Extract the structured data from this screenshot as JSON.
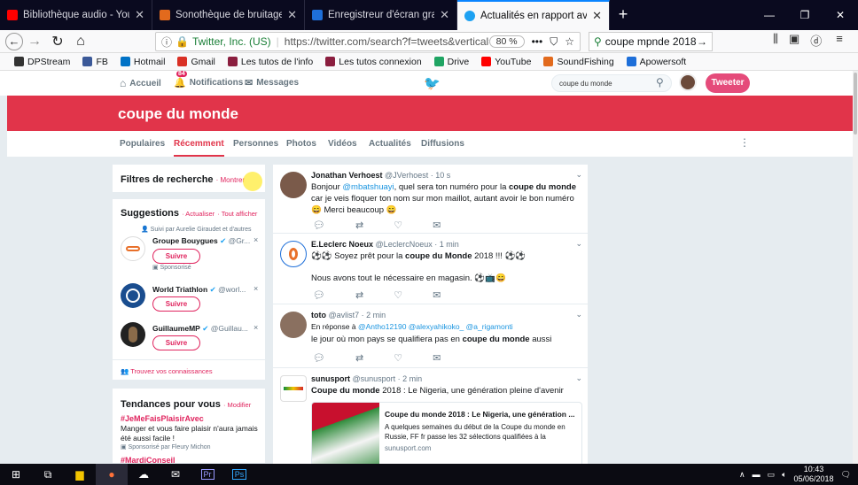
{
  "browser": {
    "tabs": [
      {
        "title": "Bibliothèque audio - YouTube",
        "color": "#ff0000"
      },
      {
        "title": "Sonothèque de bruitages et mu",
        "color": "#e26a1d"
      },
      {
        "title": "Enregistreur d'écran gratuit - en",
        "color": "#1e6fd9"
      },
      {
        "title": "Actualités en rapport avec coup",
        "color": "#1da1f2"
      }
    ],
    "new_tab": "+",
    "url_site": "Twitter, Inc. (US)",
    "url": "https://twitter.com/search?f=tweets&vertical=",
    "zoom": "80 %",
    "search_value": "coupe mpnde 2018",
    "bookmarks": [
      {
        "label": "DPStream",
        "color": "#333333"
      },
      {
        "label": "FB",
        "color": "#3b5998"
      },
      {
        "label": "Hotmail",
        "color": "#0072c6"
      },
      {
        "label": "Gmail",
        "color": "#d93025"
      },
      {
        "label": "Les tutos de l'info",
        "color": "#8b1e3f"
      },
      {
        "label": "Les tutos connexion",
        "color": "#8b1e3f"
      },
      {
        "label": "Drive",
        "color": "#1fa463"
      },
      {
        "label": "YouTube",
        "color": "#ff0000"
      },
      {
        "label": "SoundFishing",
        "color": "#e26a1d"
      },
      {
        "label": "Apowersoft",
        "color": "#1e6fd9"
      }
    ]
  },
  "twitter": {
    "nav_home": "Accueil",
    "nav_notifications": "Notifications",
    "notif_count": "84",
    "nav_messages": "Messages",
    "search_value": "coupe du monde",
    "tweet_button": "Tweeter",
    "banner_title": "coupe du monde",
    "tabs": [
      "Populaires",
      "Récemment",
      "Personnes",
      "Photos",
      "Vidéos",
      "Actualités",
      "Diffusions"
    ],
    "filters": {
      "title": "Filtres de recherche",
      "show": "· Montrer"
    },
    "suggestions": {
      "title": "Suggestions",
      "refresh": "· Actualiser",
      "all": "· Tout afficher",
      "followed_by": "Suivi par Aurelie Giraudet et d'autres",
      "follow_label": "Suivre",
      "sponsored": "Sponsorisé",
      "users": [
        {
          "name": "Groupe Bouygues",
          "handle": "@Gr...",
          "color": "#e8702a"
        },
        {
          "name": "World Triathlon",
          "handle": "@worl...",
          "color": "#1a4d8f"
        },
        {
          "name": "GuillaumeMP",
          "handle": "@Guillau...",
          "color": "#222222"
        }
      ],
      "find_friends": "Trouvez vos connaissances"
    },
    "trends": {
      "title": "Tendances pour vous",
      "edit": "· Modifier",
      "items": [
        {
          "tag": "#JeMeFaisPlaisirAvec",
          "desc": "Manger et vous faire plaisir n'aura jamais été aussi facile !",
          "promo": "Sponsorisé par Fleury Michon"
        },
        {
          "tag": "#MardiConseil"
        }
      ]
    },
    "tweets": [
      {
        "name": "Jonathan Verhoest",
        "handle": "@JVerhoest · 10 s",
        "text_a": "Bonjour ",
        "mention": "@mbatshuayi",
        "text_b": ", quel sera ton numéro pour la ",
        "bold": "coupe du monde",
        "text_c": " car je veis floquer ton nom sur mon maillot, autant avoir le bon numéro 😄 Merci beaucoup 😄"
      },
      {
        "name": "E.Leclerc Noeux",
        "handle": "@LeclercNoeux · 1 min",
        "text_a": "⚽⚽ Soyez prêt pour la ",
        "bold": "coupe du Monde",
        "text_b": " 2018 !!! ⚽⚽",
        "text_c": "Nous avons tout le nécessaire en magasin. ⚽📺😄"
      },
      {
        "name": "toto",
        "handle": "@avlist7 · 2 min",
        "reply_label": "En réponse à ",
        "reply_to": "@Antho12190 @alexyahikoko_ @a_rigamonti",
        "text_a": "le jour où mon pays se qualifiera pas en ",
        "bold": "coupe du monde",
        "text_b": " aussi"
      },
      {
        "name": "sunusport",
        "handle": "@sunusport · 2 min",
        "bold": "Coupe du monde",
        "text_a": " 2018 : Le Nigeria, une génération pleine d'avenir",
        "card_title": "Coupe du monde 2018 : Le Nigeria, une génération ...",
        "card_desc": "A quelques semaines du début de la Coupe du monde en Russie, FF fr passe les 32 sélections qualifiées à la",
        "card_domain": "sunusport.com"
      }
    ]
  },
  "taskbar": {
    "time": "10:43",
    "date": "05/06/2018"
  }
}
